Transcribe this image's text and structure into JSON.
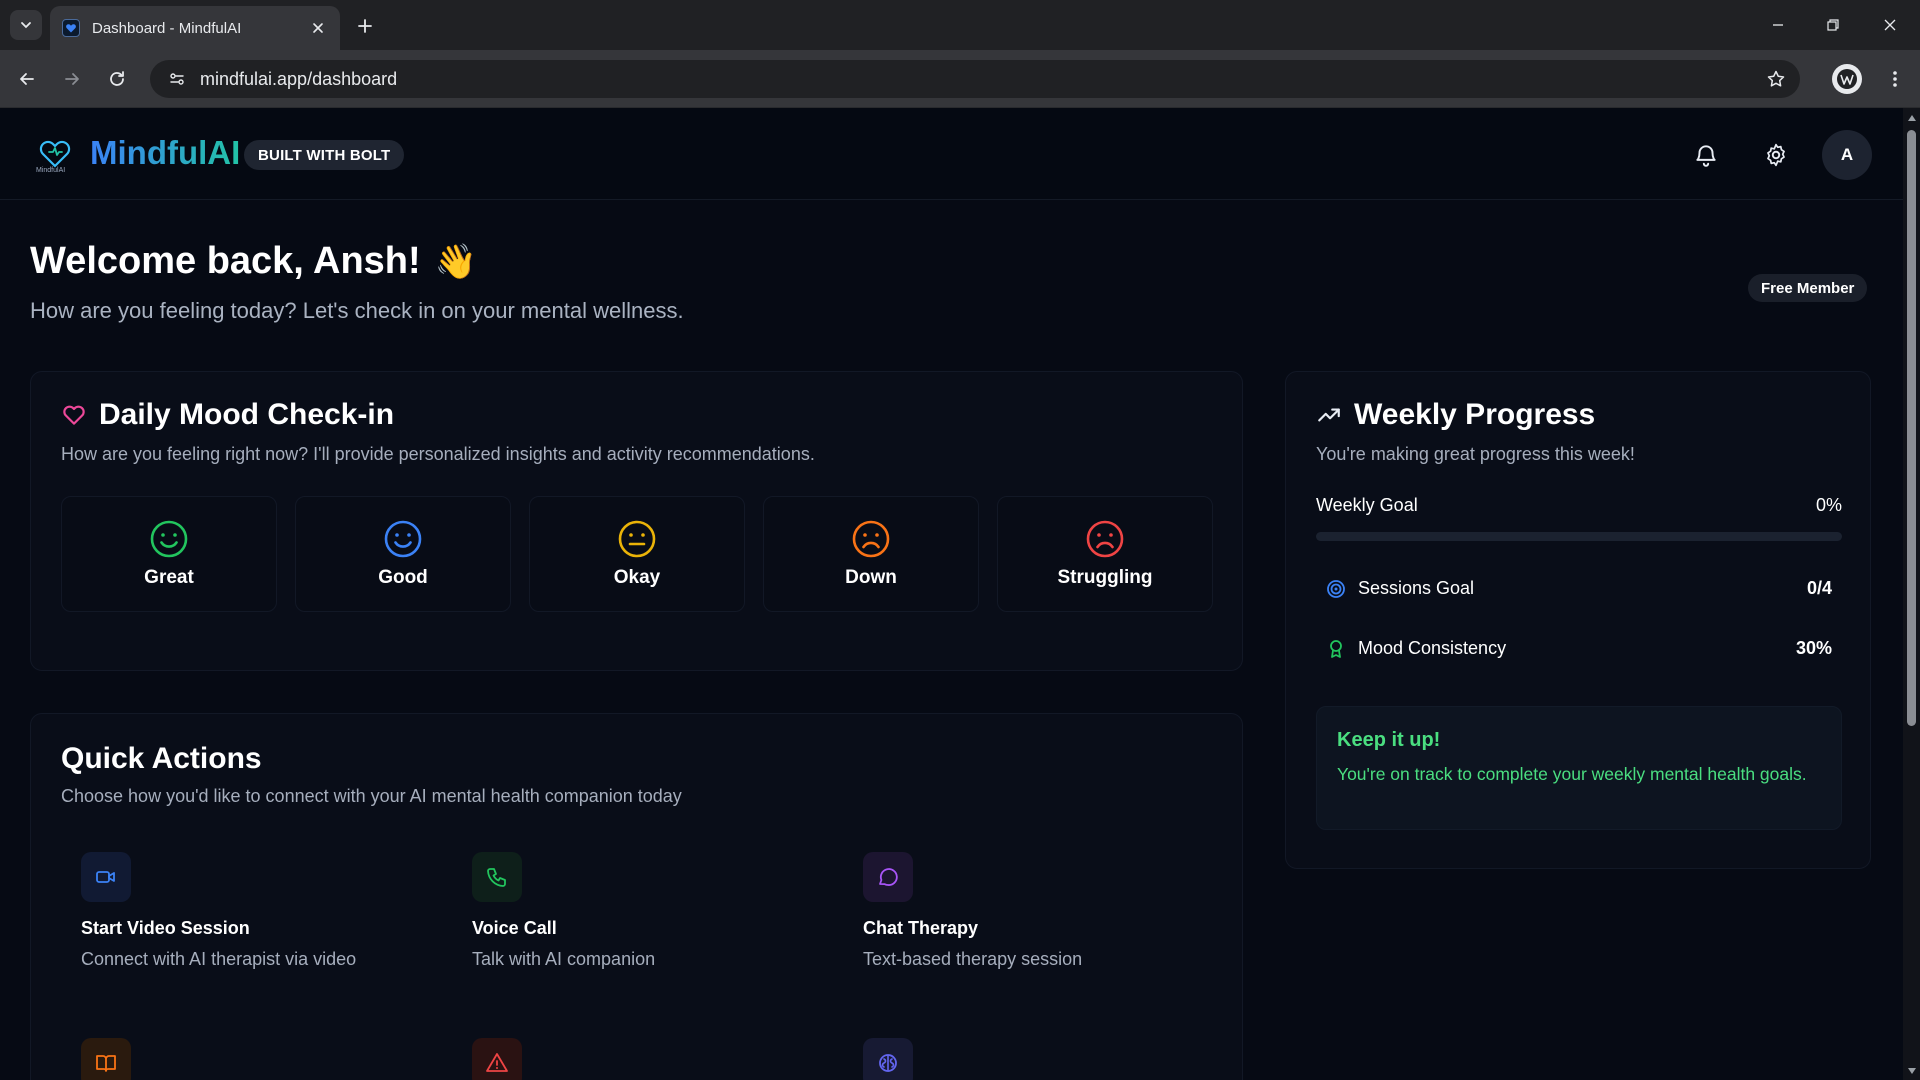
{
  "browser": {
    "tab_title": "Dashboard - MindfulAI",
    "url": "mindfulai.app/dashboard"
  },
  "header": {
    "brand": "MindfulAI",
    "logo_sub": "MindfulAI",
    "badge": "BUILT WITH BOLT",
    "avatar_initial": "A"
  },
  "welcome": {
    "title": "Welcome back, Ansh!",
    "emoji": "👋",
    "subtitle": "How are you feeling today? Let's check in on your mental wellness.",
    "member_badge": "Free Member"
  },
  "mood": {
    "title": "Daily Mood Check-in",
    "subtitle": "How are you feeling right now? I'll provide personalized insights and activity recommendations.",
    "options": [
      {
        "label": "Great",
        "color": "#22c55e"
      },
      {
        "label": "Good",
        "color": "#3b82f6"
      },
      {
        "label": "Okay",
        "color": "#eab308"
      },
      {
        "label": "Down",
        "color": "#f97316"
      },
      {
        "label": "Struggling",
        "color": "#ef4444"
      }
    ]
  },
  "progress": {
    "title": "Weekly Progress",
    "subtitle": "You're making great progress this week!",
    "weekly_goal_label": "Weekly Goal",
    "weekly_goal_value": "0%",
    "weekly_goal_fraction": 0,
    "sessions_label": "Sessions Goal",
    "sessions_value": "0/4",
    "mood_label": "Mood Consistency",
    "mood_value": "30%",
    "keep_title": "Keep it up!",
    "keep_text": "You're on track to complete your weekly mental health goals."
  },
  "quick_actions": {
    "title": "Quick Actions",
    "subtitle": "Choose how you'd like to connect with your AI mental health companion today",
    "items": [
      {
        "title": "Start Video Session",
        "desc": "Connect with AI therapist via video",
        "icon": "video-icon"
      },
      {
        "title": "Voice Call",
        "desc": "Talk with AI companion",
        "icon": "phone-icon"
      },
      {
        "title": "Chat Therapy",
        "desc": "Text-based therapy session",
        "icon": "chat-bubble-icon"
      }
    ],
    "partial_icons": [
      "book-icon",
      "alert-triangle-icon",
      "brain-icon"
    ]
  }
}
